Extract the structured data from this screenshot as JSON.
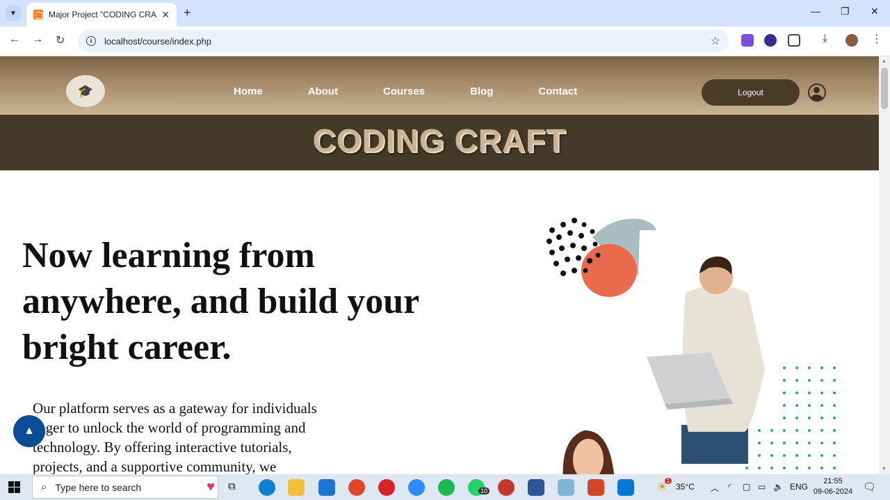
{
  "browser": {
    "tab_title": "Major Project \"CODING CRAFT\"",
    "url": "localhost/course/index.php"
  },
  "site": {
    "nav": [
      "Home",
      "About",
      "Courses",
      "Blog",
      "Contact"
    ],
    "logout_label": "Logout",
    "banner_title": "CODING CRAFT",
    "hero_title": "Now learning from anywhere, and build your bright career.",
    "hero_text": "Our platform serves as a gateway for individuals eager to unlock the world of programming and technology. By offering interactive tutorials, projects, and a supportive community, we"
  },
  "taskbar": {
    "search_placeholder": "Type here to search",
    "weather": "35°C",
    "language": "ENG",
    "time": "21:55",
    "date": "09-06-2024",
    "whatsapp_badge": "10",
    "weather_badge": "1"
  },
  "colors": {
    "header_gradient_top": "#7b6446",
    "header_gradient_bottom": "#c9b594",
    "banner_bg": "#453a28",
    "logout_bg": "#4a3b27",
    "fab_bg": "#0b4c96"
  }
}
